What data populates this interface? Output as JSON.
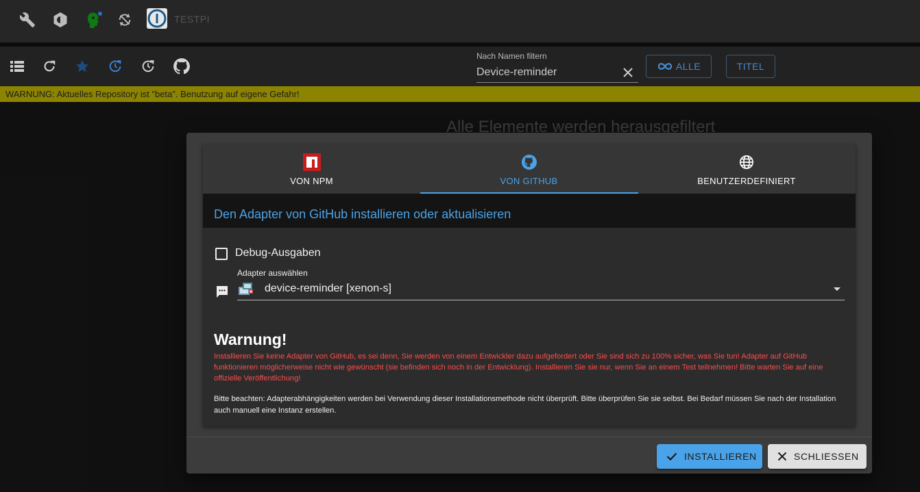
{
  "topbar": {
    "icons": [
      "wrench-icon",
      "settings-icon",
      "user-head-icon",
      "sync-icon"
    ],
    "host_name": "TESTPI",
    "colors": {
      "head_icon": "#0f7a14",
      "status_dot": "#2a6fb8"
    }
  },
  "toolbar": {
    "icons": [
      "list-icon",
      "refresh-icon",
      "star-icon",
      "update-icon",
      "history-icon",
      "github-icon"
    ],
    "filter": {
      "label": "Nach Namen filtern",
      "value": "Device-reminder"
    },
    "buttons": {
      "all_label": "ALLE",
      "title_label": "TITEL"
    }
  },
  "warning_bar": {
    "text": "WARNUNG: Aktuelles Repository ist \"beta\". Benutzung auf eigene Gefahr!",
    "color": "#8c8400"
  },
  "background": {
    "empty_text": "Alle Elemente werden herausgefiltert"
  },
  "dialog": {
    "tabs": [
      {
        "label": "VON NPM",
        "icon": "npm-icon"
      },
      {
        "label": "VON GITHUB",
        "icon": "github-icon"
      },
      {
        "label": "BENUTZERDEFINIERT",
        "icon": "globe-icon"
      }
    ],
    "active_tab": "VON GITHUB",
    "heading": "Den Adapter von GitHub installieren oder aktualisieren",
    "debug_label": "Debug-Ausgaben",
    "debug_checked": false,
    "select": {
      "label": "Adapter auswählen",
      "value": "device-reminder [xenon-s]"
    },
    "warning_title": "Warnung!",
    "warning_text": "Installieren Sie keine Adapter von GitHub, es sei denn, Sie werden von einem Entwickler dazu aufgefordert oder Sie sind sich zu 100% sicher, was Sie tun! Adapter auf GitHub funktionieren möglicherweise nicht wie gewünscht (sie befinden sich noch in der Entwicklung). Installieren Sie sie nur, wenn Sie an einem Test teilnehmen! Bitte warten Sie auf eine offizielle Veröffentlichung!",
    "note_text": "Bitte beachten: Adapterabhängigkeiten werden bei Verwendung dieser Installationsmethode nicht überprüft. Bitte überprüfen Sie sie selbst. Bei Bedarf müssen Sie nach der Installation auch manuell eine Instanz erstellen.",
    "buttons": {
      "install": "INSTALLIEREN",
      "close": "SCHLIESSEN"
    },
    "colors": {
      "accent": "#4aa3e8",
      "warning": "#ff4b4b"
    }
  }
}
